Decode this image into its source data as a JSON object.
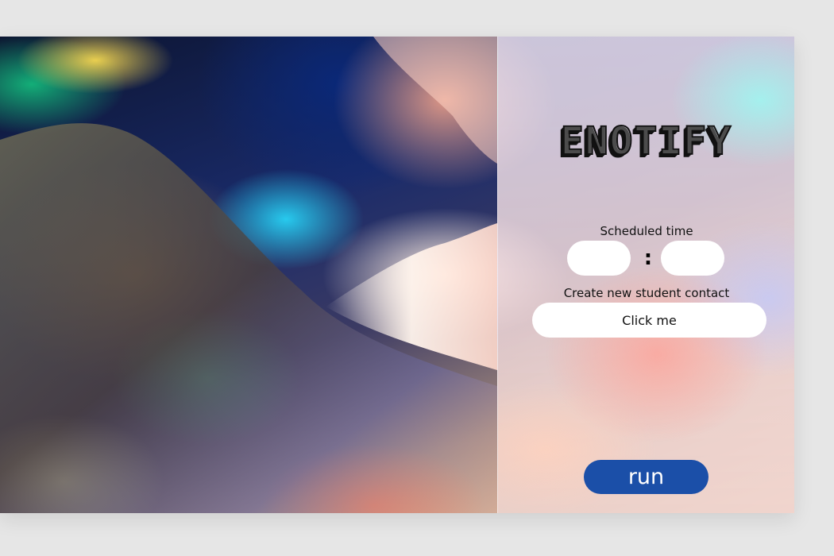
{
  "app": {
    "title": "ENOTIFY"
  },
  "schedule": {
    "label": "Scheduled time",
    "separator": ":",
    "hours_value": "",
    "minutes_value": ""
  },
  "contact": {
    "label": "Create new student contact",
    "button_label": "Click me"
  },
  "actions": {
    "run_label": "run"
  },
  "colors": {
    "page_background": "#e6e6e6",
    "run_button": "#1b4fa8",
    "run_text": "#ffffff",
    "input_background": "#ffffff",
    "text": "#111111"
  }
}
